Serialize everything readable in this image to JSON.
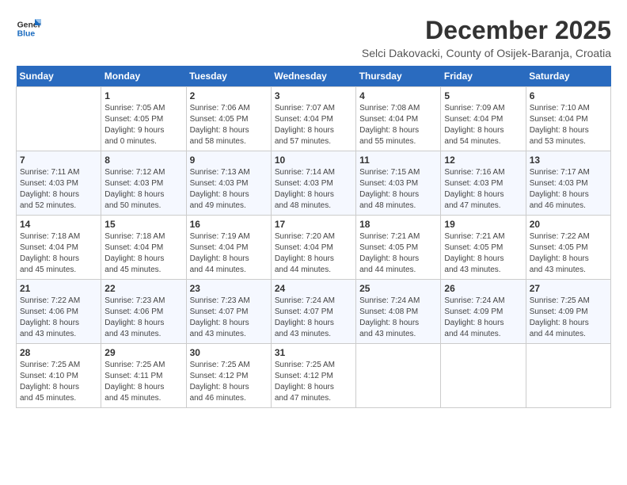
{
  "logo": {
    "line1": "General",
    "line2": "Blue"
  },
  "header": {
    "month": "December 2025",
    "location": "Selci Dakovacki, County of Osijek-Baranja, Croatia"
  },
  "weekdays": [
    "Sunday",
    "Monday",
    "Tuesday",
    "Wednesday",
    "Thursday",
    "Friday",
    "Saturday"
  ],
  "weeks": [
    [
      {
        "day": "",
        "info": ""
      },
      {
        "day": "1",
        "info": "Sunrise: 7:05 AM\nSunset: 4:05 PM\nDaylight: 9 hours\nand 0 minutes."
      },
      {
        "day": "2",
        "info": "Sunrise: 7:06 AM\nSunset: 4:05 PM\nDaylight: 8 hours\nand 58 minutes."
      },
      {
        "day": "3",
        "info": "Sunrise: 7:07 AM\nSunset: 4:04 PM\nDaylight: 8 hours\nand 57 minutes."
      },
      {
        "day": "4",
        "info": "Sunrise: 7:08 AM\nSunset: 4:04 PM\nDaylight: 8 hours\nand 55 minutes."
      },
      {
        "day": "5",
        "info": "Sunrise: 7:09 AM\nSunset: 4:04 PM\nDaylight: 8 hours\nand 54 minutes."
      },
      {
        "day": "6",
        "info": "Sunrise: 7:10 AM\nSunset: 4:04 PM\nDaylight: 8 hours\nand 53 minutes."
      }
    ],
    [
      {
        "day": "7",
        "info": "Sunrise: 7:11 AM\nSunset: 4:03 PM\nDaylight: 8 hours\nand 52 minutes."
      },
      {
        "day": "8",
        "info": "Sunrise: 7:12 AM\nSunset: 4:03 PM\nDaylight: 8 hours\nand 50 minutes."
      },
      {
        "day": "9",
        "info": "Sunrise: 7:13 AM\nSunset: 4:03 PM\nDaylight: 8 hours\nand 49 minutes."
      },
      {
        "day": "10",
        "info": "Sunrise: 7:14 AM\nSunset: 4:03 PM\nDaylight: 8 hours\nand 48 minutes."
      },
      {
        "day": "11",
        "info": "Sunrise: 7:15 AM\nSunset: 4:03 PM\nDaylight: 8 hours\nand 48 minutes."
      },
      {
        "day": "12",
        "info": "Sunrise: 7:16 AM\nSunset: 4:03 PM\nDaylight: 8 hours\nand 47 minutes."
      },
      {
        "day": "13",
        "info": "Sunrise: 7:17 AM\nSunset: 4:03 PM\nDaylight: 8 hours\nand 46 minutes."
      }
    ],
    [
      {
        "day": "14",
        "info": "Sunrise: 7:18 AM\nSunset: 4:04 PM\nDaylight: 8 hours\nand 45 minutes."
      },
      {
        "day": "15",
        "info": "Sunrise: 7:18 AM\nSunset: 4:04 PM\nDaylight: 8 hours\nand 45 minutes."
      },
      {
        "day": "16",
        "info": "Sunrise: 7:19 AM\nSunset: 4:04 PM\nDaylight: 8 hours\nand 44 minutes."
      },
      {
        "day": "17",
        "info": "Sunrise: 7:20 AM\nSunset: 4:04 PM\nDaylight: 8 hours\nand 44 minutes."
      },
      {
        "day": "18",
        "info": "Sunrise: 7:21 AM\nSunset: 4:05 PM\nDaylight: 8 hours\nand 44 minutes."
      },
      {
        "day": "19",
        "info": "Sunrise: 7:21 AM\nSunset: 4:05 PM\nDaylight: 8 hours\nand 43 minutes."
      },
      {
        "day": "20",
        "info": "Sunrise: 7:22 AM\nSunset: 4:05 PM\nDaylight: 8 hours\nand 43 minutes."
      }
    ],
    [
      {
        "day": "21",
        "info": "Sunrise: 7:22 AM\nSunset: 4:06 PM\nDaylight: 8 hours\nand 43 minutes."
      },
      {
        "day": "22",
        "info": "Sunrise: 7:23 AM\nSunset: 4:06 PM\nDaylight: 8 hours\nand 43 minutes."
      },
      {
        "day": "23",
        "info": "Sunrise: 7:23 AM\nSunset: 4:07 PM\nDaylight: 8 hours\nand 43 minutes."
      },
      {
        "day": "24",
        "info": "Sunrise: 7:24 AM\nSunset: 4:07 PM\nDaylight: 8 hours\nand 43 minutes."
      },
      {
        "day": "25",
        "info": "Sunrise: 7:24 AM\nSunset: 4:08 PM\nDaylight: 8 hours\nand 43 minutes."
      },
      {
        "day": "26",
        "info": "Sunrise: 7:24 AM\nSunset: 4:09 PM\nDaylight: 8 hours\nand 44 minutes."
      },
      {
        "day": "27",
        "info": "Sunrise: 7:25 AM\nSunset: 4:09 PM\nDaylight: 8 hours\nand 44 minutes."
      }
    ],
    [
      {
        "day": "28",
        "info": "Sunrise: 7:25 AM\nSunset: 4:10 PM\nDaylight: 8 hours\nand 45 minutes."
      },
      {
        "day": "29",
        "info": "Sunrise: 7:25 AM\nSunset: 4:11 PM\nDaylight: 8 hours\nand 45 minutes."
      },
      {
        "day": "30",
        "info": "Sunrise: 7:25 AM\nSunset: 4:12 PM\nDaylight: 8 hours\nand 46 minutes."
      },
      {
        "day": "31",
        "info": "Sunrise: 7:25 AM\nSunset: 4:12 PM\nDaylight: 8 hours\nand 47 minutes."
      },
      {
        "day": "",
        "info": ""
      },
      {
        "day": "",
        "info": ""
      },
      {
        "day": "",
        "info": ""
      }
    ]
  ]
}
